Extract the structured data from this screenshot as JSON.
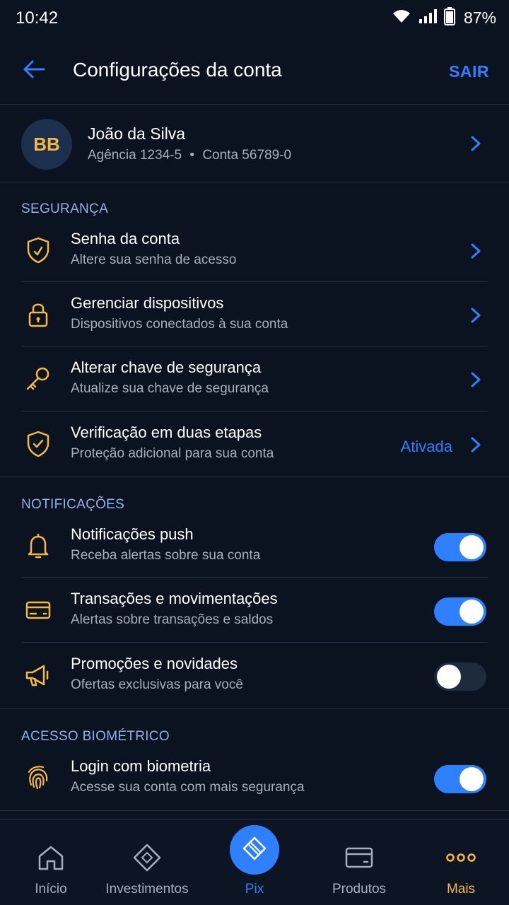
{
  "status_bar": {
    "time": "10:42",
    "battery": "87%"
  },
  "header": {
    "title": "Configurações da conta",
    "logout_label": "SAIR"
  },
  "profile": {
    "initials": "BB",
    "name": "João da Silva",
    "agency": "Agência 1234-5",
    "separator": "•",
    "account": "Conta 56789-0"
  },
  "security": {
    "label": "SEGURANÇA",
    "items": [
      {
        "title": "Senha da conta",
        "subtitle": "Altere sua senha de acesso"
      },
      {
        "title": "Gerenciar dispositivos",
        "subtitle": "Dispositivos conectados à sua conta"
      },
      {
        "title": "Alterar chave de segurança",
        "subtitle": "Atualize sua chave de segurança"
      },
      {
        "title": "Verificação em duas etapas",
        "subtitle": "Proteção adicional para sua conta",
        "status": "Ativada"
      }
    ]
  },
  "notifications": {
    "label": "NOTIFICAÇÕES",
    "items": [
      {
        "title": "Notificações push",
        "subtitle": "Receba alertas sobre sua conta",
        "enabled": true
      },
      {
        "title": "Transações e movimentações",
        "subtitle": "Alertas sobre transações e saldos",
        "enabled": true
      },
      {
        "title": "Promoções e novidades",
        "subtitle": "Ofertas exclusivas para você",
        "enabled": false
      }
    ]
  },
  "biometric": {
    "label": "ACESSO BIOMÉTRICO",
    "items": [
      {
        "title": "Login com biometria",
        "subtitle": "Acesse sua conta com mais segurança",
        "enabled": true
      }
    ]
  },
  "bottom_nav": {
    "items": [
      {
        "label": "Início",
        "icon": "home-icon"
      },
      {
        "label": "Investimentos",
        "icon": "diamond-icon"
      },
      {
        "label": "Pix",
        "icon": "pix-icon",
        "active": true
      },
      {
        "label": "Produtos",
        "icon": "card-icon"
      },
      {
        "label": "Mais",
        "icon": "more-icon"
      }
    ]
  },
  "colors": {
    "background": "#0b1220",
    "accent_blue": "#2f80ff",
    "accent_gold": "#f5b942",
    "section_label": "#8fb1e8",
    "subtitle": "#a6afbe"
  }
}
